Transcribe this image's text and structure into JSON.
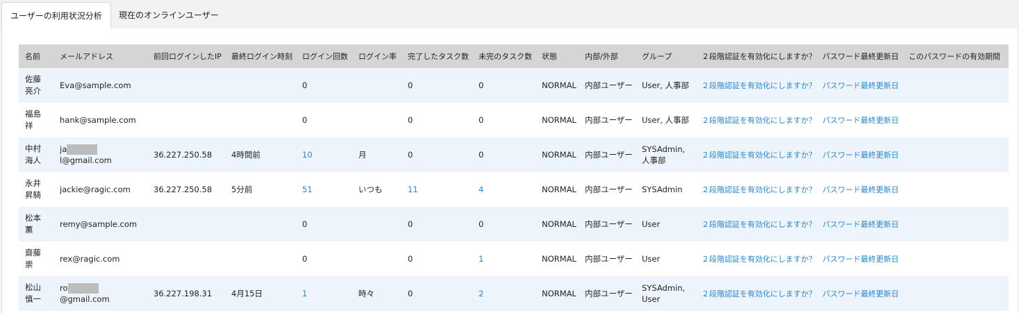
{
  "tabs": [
    {
      "label": "ユーザーの利用状況分析",
      "active": true
    },
    {
      "label": "現在のオンラインユーザー",
      "active": false
    }
  ],
  "table": {
    "headers": [
      "名前",
      "メールアドレス",
      "前回ログインしたIP",
      "最終ログイン時刻",
      "ログイン回数",
      "ログイン率",
      "完了したタスク数",
      "未完のタスク数",
      "状態",
      "内部/外部",
      "グループ",
      "２段階認証を有効化にしますか？",
      "パスワード最終更新日",
      "このパスワードの有効期間"
    ],
    "rows": [
      {
        "name": "佐藤亮介",
        "email": "Eva@sample.com",
        "ip": "",
        "last_login": "",
        "login_count": "0",
        "login_rate": "",
        "done_tasks": "0",
        "open_tasks": "0",
        "status": "NORMAL",
        "type": "内部ユーザー",
        "group": "User, 人事部",
        "twofa": "２段階認証を有効化にしますか？",
        "pw_updated": "パスワード最終更新日",
        "pw_valid": ""
      },
      {
        "name": "福島祥",
        "email": "hank@sample.com",
        "ip": "",
        "last_login": "",
        "login_count": "0",
        "login_rate": "",
        "done_tasks": "0",
        "open_tasks": "0",
        "status": "NORMAL",
        "type": "内部ユーザー",
        "group": "User, 人事部",
        "twofa": "２段階認証を有効化にしますか？",
        "pw_updated": "パスワード最終更新日",
        "pw_valid": ""
      },
      {
        "name": "中村海人",
        "email_prefix": "ja",
        "email_suffix": "l@gmail.com",
        "ip": "36.227.250.58",
        "last_login": "4時間前",
        "login_count": "10",
        "login_rate": "月",
        "done_tasks": "0",
        "open_tasks": "0",
        "status": "NORMAL",
        "type": "内部ユーザー",
        "group": "SYSAdmin, 人事部",
        "twofa": "２段階認証を有効化にしますか？",
        "pw_updated": "パスワード最終更新日",
        "pw_valid": ""
      },
      {
        "name": "永井昇騎",
        "email": "jackie@ragic.com",
        "ip": "36.227.250.58",
        "last_login": "5分前",
        "login_count": "51",
        "login_rate": "いつも",
        "done_tasks": "11",
        "open_tasks": "4",
        "status": "NORMAL",
        "type": "内部ユーザー",
        "group": "SYSAdmin",
        "twofa": "２段階認証を有効化にしますか？",
        "pw_updated": "パスワード最終更新日",
        "pw_valid": ""
      },
      {
        "name": "松本薫",
        "email": "remy@sample.com",
        "ip": "",
        "last_login": "",
        "login_count": "0",
        "login_rate": "",
        "done_tasks": "0",
        "open_tasks": "0",
        "status": "NORMAL",
        "type": "内部ユーザー",
        "group": "User",
        "twofa": "２段階認証を有効化にしますか？",
        "pw_updated": "パスワード最終更新日",
        "pw_valid": ""
      },
      {
        "name": "齋藤崇",
        "email": "rex@ragic.com",
        "ip": "",
        "last_login": "",
        "login_count": "0",
        "login_rate": "",
        "done_tasks": "0",
        "open_tasks": "1",
        "status": "NORMAL",
        "type": "内部ユーザー",
        "group": "User",
        "twofa": "２段階認証を有効化にしますか？",
        "pw_updated": "パスワード最終更新日",
        "pw_valid": ""
      },
      {
        "name": "松山慎一",
        "email_prefix": "ro",
        "email_suffix": "@gmail.com",
        "ip": "36.227.198.31",
        "last_login": "4月15日",
        "login_count": "1",
        "login_rate": "時々",
        "done_tasks": "0",
        "open_tasks": "2",
        "status": "NORMAL",
        "type": "内部ユーザー",
        "group": "SYSAdmin, User",
        "twofa": "２段階認証を有効化にしますか？",
        "pw_updated": "パスワード最終更新日",
        "pw_valid": ""
      }
    ]
  },
  "colors": {
    "link": "#2a86c9",
    "header_bg": "#d5d5d5",
    "row_alt_bg": "#eef4fb",
    "redaction": "#bdbdbd"
  }
}
